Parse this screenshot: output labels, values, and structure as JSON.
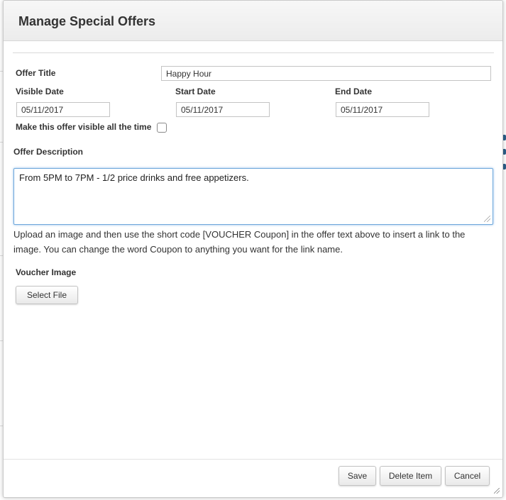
{
  "dialog": {
    "title": "Manage Special Offers"
  },
  "form": {
    "offer_title": {
      "label": "Offer Title",
      "value": "Happy Hour"
    },
    "visible_date": {
      "label": "Visible Date",
      "value": "05/11/2017"
    },
    "start_date": {
      "label": "Start Date",
      "value": "05/11/2017"
    },
    "end_date": {
      "label": "End Date",
      "value": "05/11/2017"
    },
    "always_visible": {
      "label": "Make this offer visible all the time",
      "checked": false
    },
    "description": {
      "label": "Offer Description",
      "value": "From 5PM to 7PM - 1/2 price drinks and free appetizers."
    },
    "help_text": "Upload an image and then use the short code [VOUCHER Coupon] in the offer text above to insert a link to the image. You can change the word Coupon to anything you want for the link name.",
    "voucher_image": {
      "label": "Voucher Image",
      "button_label": "Select File"
    }
  },
  "footer": {
    "save_label": "Save",
    "delete_label": "Delete Item",
    "cancel_label": "Cancel"
  }
}
